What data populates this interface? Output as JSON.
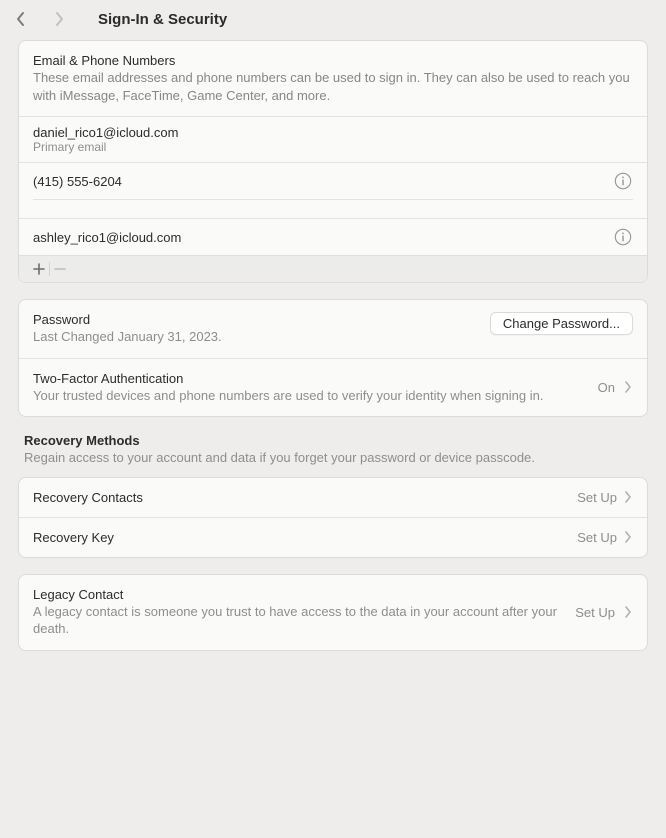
{
  "header": {
    "title": "Sign-In & Security"
  },
  "email_phone": {
    "title": "Email & Phone Numbers",
    "desc": "These email addresses and phone numbers can be used to sign in. They can also be used to reach you with iMessage, FaceTime, Game Center, and more.",
    "items": [
      {
        "value": "daniel_rico1@icloud.com",
        "sub": "Primary email",
        "has_info": false
      },
      {
        "value": "(415) 555-6204",
        "sub": "",
        "has_info": true
      },
      {
        "value": "ashley_rico1@icloud.com",
        "sub": "",
        "has_info": true
      }
    ]
  },
  "password": {
    "title": "Password",
    "sub": "Last Changed January 31, 2023.",
    "button": "Change Password..."
  },
  "twofa": {
    "title": "Two-Factor Authentication",
    "desc": "Your trusted devices and phone numbers are used to verify your identity when signing in.",
    "status": "On"
  },
  "recovery": {
    "header": "Recovery Methods",
    "desc": "Regain access to your account and data if you forget your password or device passcode.",
    "items": [
      {
        "label": "Recovery Contacts",
        "status": "Set Up"
      },
      {
        "label": "Recovery Key",
        "status": "Set Up"
      }
    ]
  },
  "legacy": {
    "title": "Legacy Contact",
    "desc": "A legacy contact is someone you trust to have access to the data in your account after your death.",
    "status": "Set Up"
  }
}
